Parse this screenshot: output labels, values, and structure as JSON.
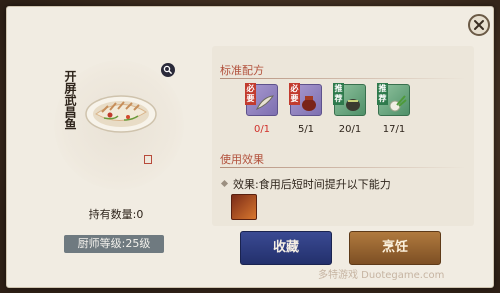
{
  "dish": {
    "name": "开屏武昌鱼",
    "owned_text": "持有数量:0",
    "chef_level_text": "厨师等级:25级"
  },
  "recipe": {
    "title": "标准配方",
    "ingredients": [
      {
        "badge": "必要",
        "count": "0/1",
        "icon": "bamboo-leaf-icon",
        "rarity": "purple",
        "insufficient": true
      },
      {
        "badge": "必要",
        "count": "5/1",
        "icon": "wine-jar-icon",
        "rarity": "purple",
        "insufficient": false
      },
      {
        "badge": "推荐",
        "count": "20/1",
        "icon": "pickle-jar-icon",
        "rarity": "green",
        "insufficient": false
      },
      {
        "badge": "推荐",
        "count": "17/1",
        "icon": "green-onion-icon",
        "rarity": "green",
        "insufficient": false
      }
    ]
  },
  "effect": {
    "title": "使用效果",
    "text": "效果:食用后短时间提升以下能力",
    "icon": "flame-buff-icon"
  },
  "buttons": {
    "collect": "收藏",
    "cook": "烹饪"
  },
  "watermark": "多特游戏 Duotegame.com",
  "colors": {
    "section_title": "#b2513c",
    "collect_button": "#2c3a7c",
    "cook_button": "#9a6632",
    "insufficient": "#d0302a"
  }
}
